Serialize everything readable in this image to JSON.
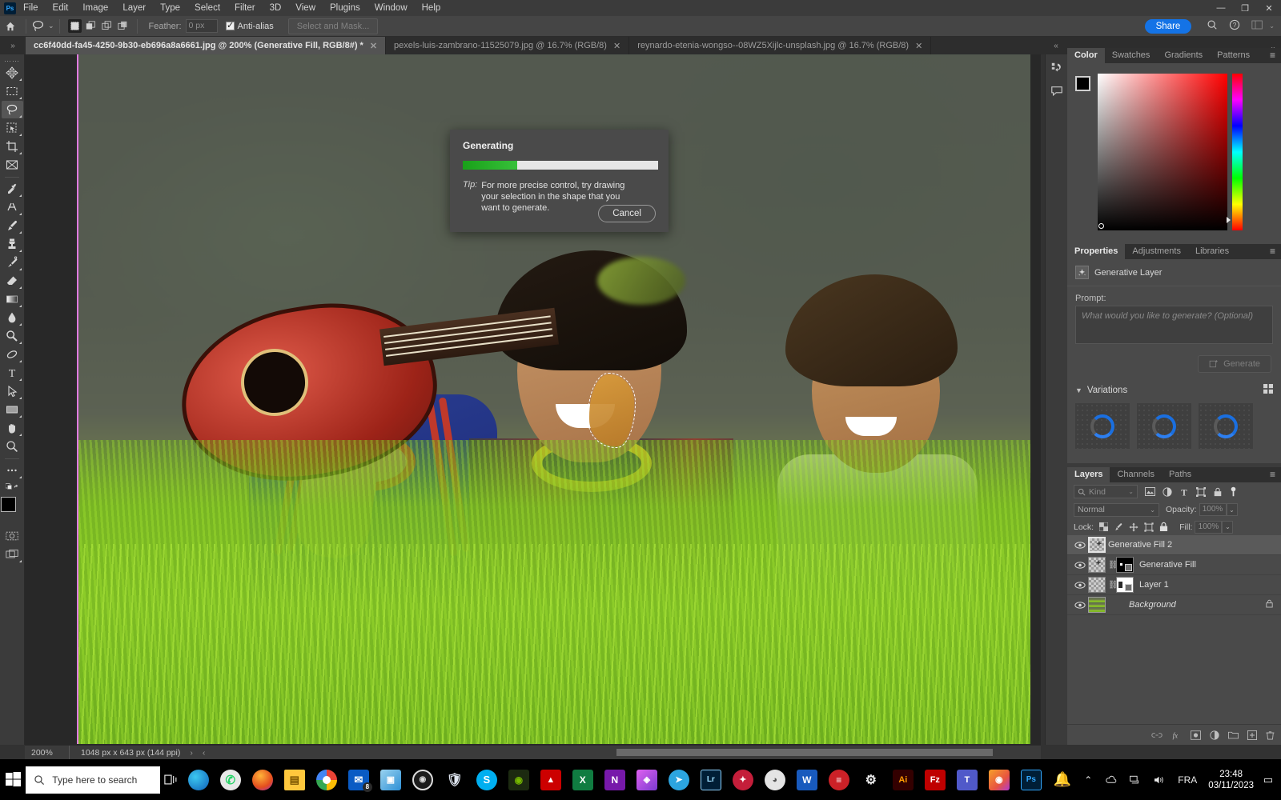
{
  "app": {
    "name": "Ps",
    "title_icon": "photoshop-logo"
  },
  "menubar": {
    "items": [
      "File",
      "Edit",
      "Image",
      "Layer",
      "Type",
      "Select",
      "Filter",
      "3D",
      "View",
      "Plugins",
      "Window",
      "Help"
    ]
  },
  "window_controls": {
    "minimize": "—",
    "maximize": "❐",
    "close": "✕"
  },
  "options_bar": {
    "home_icon": "home-icon",
    "tool_icon": "lasso-icon",
    "tool_chevron": "⌄",
    "selection_modes": [
      "new-selection",
      "add-to-selection",
      "subtract-from-selection",
      "intersect-selection"
    ],
    "feather_label": "Feather:",
    "feather_value": "0 px",
    "antialias_label": "Anti-alias",
    "select_and_mask_label": "Select and Mask...",
    "share_label": "Share",
    "search_icon": "search-icon",
    "help_icon": "help-icon",
    "workspace_icon": "workspace-icon"
  },
  "document_tabs": {
    "collapse_icon": "»",
    "tabs": [
      {
        "label": "cc6f40dd-fa45-4250-9b30-eb696a8a6661.jpg @ 200% (Generative Fill, RGB/8#) *",
        "active": true,
        "close": "✕"
      },
      {
        "label": "pexels-luis-zambrano-11525079.jpg @ 16.7% (RGB/8)",
        "active": false,
        "close": "✕"
      },
      {
        "label": "reynardo-etenia-wongso--08WZ5Xijlc-unsplash.jpg @ 16.7% (RGB/8)",
        "active": false,
        "close": "✕"
      }
    ],
    "right_chevron": "»"
  },
  "toolbar": {
    "handle": "⋯⋯",
    "tools": [
      {
        "name": "move-tool",
        "active": false
      },
      {
        "name": "rectangular-marquee-tool",
        "active": false
      },
      {
        "name": "lasso-tool",
        "active": true
      },
      {
        "name": "object-selection-tool",
        "active": false
      },
      {
        "name": "crop-tool",
        "active": false
      },
      {
        "name": "frame-tool",
        "active": false
      },
      {
        "name": "eyedropper-tool",
        "active": false
      },
      {
        "name": "spot-healing-brush-tool",
        "active": false
      },
      {
        "name": "brush-tool",
        "active": false
      },
      {
        "name": "clone-stamp-tool",
        "active": false
      },
      {
        "name": "history-brush-tool",
        "active": false
      },
      {
        "name": "eraser-tool",
        "active": false
      },
      {
        "name": "gradient-tool",
        "active": false
      },
      {
        "name": "blur-tool",
        "active": false
      },
      {
        "name": "dodge-tool",
        "active": false
      },
      {
        "name": "pen-tool",
        "active": false
      },
      {
        "name": "type-tool",
        "active": false
      },
      {
        "name": "path-selection-tool",
        "active": false
      },
      {
        "name": "rectangle-tool",
        "active": false
      },
      {
        "name": "hand-tool",
        "active": false
      },
      {
        "name": "zoom-tool",
        "active": false
      },
      {
        "name": "edit-toolbar-tool",
        "active": false
      }
    ],
    "foreground_color": "#000000",
    "background_color": "#ffffff",
    "quick_mask_icon": "quick-mask-icon",
    "screen_mode_icon": "screen-mode-icon"
  },
  "generating_dialog": {
    "title": "Generating",
    "progress_percent": 28,
    "tip_label": "Tip:",
    "tip_text": "For more precise control, try drawing your selection in the shape that you want to generate.",
    "cancel_label": "Cancel"
  },
  "status_bar": {
    "zoom": "200%",
    "doc_info": "1048 px x 643 px (144 ppi)",
    "right_arrow": "›",
    "left_arrow": "‹"
  },
  "dock_rail": {
    "icons": [
      "history-panel-icon",
      "comments-panel-icon"
    ]
  },
  "color_panel": {
    "tabs": [
      "Color",
      "Swatches",
      "Gradients",
      "Patterns"
    ],
    "active_tab": "Color",
    "menu_icon": "panel-menu-icon",
    "foreground": "#000000",
    "background": "#ffffff"
  },
  "properties_panel": {
    "tabs": [
      "Properties",
      "Adjustments",
      "Libraries"
    ],
    "active_tab": "Properties",
    "menu_icon": "panel-menu-icon",
    "layer_type": "Generative Layer",
    "prompt_label": "Prompt:",
    "prompt_placeholder": "What would you like to generate? (Optional)",
    "prompt_value": "",
    "generate_label": "Generate",
    "variations_label": "Variations",
    "variations": [
      {
        "state": "loading"
      },
      {
        "state": "loading"
      },
      {
        "state": "loading"
      }
    ]
  },
  "layers_panel": {
    "tabs": [
      "Layers",
      "Channels",
      "Paths"
    ],
    "active_tab": "Layers",
    "menu_icon": "panel-menu-icon",
    "filter_kind": "Kind",
    "filter_icons": [
      "pixel-filter-icon",
      "adjustment-filter-icon",
      "type-filter-icon",
      "shape-filter-icon",
      "smart-object-filter-icon"
    ],
    "filter_toggle": "filter-toggle-icon",
    "blend_mode": "Normal",
    "opacity_label": "Opacity:",
    "opacity_value": "100%",
    "lock_label": "Lock:",
    "lock_icons": [
      "lock-transparent-pixels-icon",
      "lock-image-pixels-icon",
      "lock-position-icon",
      "lock-artboard-icon",
      "lock-all-icon"
    ],
    "fill_label": "Fill:",
    "fill_value": "100%",
    "layers": [
      {
        "name": "Generative Fill 2",
        "visible": true,
        "selected": true,
        "has_mask": false,
        "linked": false,
        "locked": false,
        "thumb": "transparent-generative"
      },
      {
        "name": "Generative Fill",
        "visible": true,
        "selected": false,
        "has_mask": true,
        "linked": true,
        "locked": false,
        "thumb": "transparent-generative",
        "mask": "black"
      },
      {
        "name": "Layer 1",
        "visible": true,
        "selected": false,
        "has_mask": true,
        "linked": true,
        "locked": false,
        "thumb": "transparent",
        "mask": "white"
      },
      {
        "name": "Background",
        "visible": true,
        "selected": false,
        "has_mask": false,
        "linked": false,
        "locked": true,
        "thumb": "photo"
      }
    ],
    "footer_icons": [
      "link-layers-icon",
      "layer-style-icon",
      "add-mask-icon",
      "adjustment-layer-icon",
      "new-group-icon",
      "new-layer-icon",
      "delete-layer-icon"
    ]
  },
  "taskbar": {
    "start_icon": "windows-start-icon",
    "search_placeholder": "Type here to search",
    "search_icon": "search-icon",
    "task_view_icon": "task-view-icon",
    "apps": [
      {
        "name": "microsoft-edge",
        "label": "e",
        "color": "#0e7ac4"
      },
      {
        "name": "whatsapp",
        "label": "✆",
        "color": "#e8e8e8"
      },
      {
        "name": "firefox",
        "label": "🦊",
        "color": "#ff7139"
      },
      {
        "name": "file-explorer",
        "label": "▤",
        "color": "#ffc83d"
      },
      {
        "name": "google-chrome",
        "label": "◎",
        "color": "#ffffff"
      },
      {
        "name": "mail",
        "label": "✉",
        "color": "#0a5bc4",
        "badge": "8"
      },
      {
        "name": "photos",
        "label": "▣",
        "color": "#2d8fd5"
      },
      {
        "name": "opera-gx",
        "label": "◉",
        "color": "#1c1c1c"
      },
      {
        "name": "windows-security",
        "label": "🛡",
        "color": "#2a5fa8"
      },
      {
        "name": "skype",
        "label": "S",
        "color": "#00aff0"
      },
      {
        "name": "nvidia",
        "label": "◎",
        "color": "#76b900"
      },
      {
        "name": "acrobat",
        "label": "▲",
        "color": "#cc0000"
      },
      {
        "name": "excel",
        "label": "X",
        "color": "#107c41"
      },
      {
        "name": "onenote",
        "label": "N",
        "color": "#7719aa"
      },
      {
        "name": "affinity",
        "label": "◈",
        "color": "#b44ae0"
      },
      {
        "name": "telegram",
        "label": "➤",
        "color": "#2ca5e0"
      },
      {
        "name": "lightroom",
        "label": "Lr",
        "color": "#001e36"
      },
      {
        "name": "wondershare",
        "label": "✦",
        "color": "#c41e3a"
      },
      {
        "name": "steam",
        "label": "◕",
        "color": "#bcbcbc"
      },
      {
        "name": "word",
        "label": "W",
        "color": "#185abd"
      },
      {
        "name": "evernote",
        "label": "≡",
        "color": "#cc2127"
      },
      {
        "name": "settings",
        "label": "⚙",
        "color": "#2b2b2b"
      },
      {
        "name": "illustrator",
        "label": "Ai",
        "color": "#330000"
      },
      {
        "name": "filezilla",
        "label": "Fz",
        "color": "#bf0000"
      },
      {
        "name": "microsoft-teams",
        "label": "T",
        "color": "#5059c9"
      },
      {
        "name": "capture-one",
        "label": "◉",
        "color": "#e8543f"
      },
      {
        "name": "photoshop",
        "label": "Ps",
        "color": "#001e36"
      }
    ],
    "tray": {
      "chevron_icon": "show-hidden-icons-icon",
      "icons": [
        "onedrive-icon",
        "network-icon",
        "volume-icon"
      ],
      "language": "FRA",
      "time": "23:48",
      "date": "03/11/2023",
      "notification_icon": "notifications-icon"
    }
  }
}
